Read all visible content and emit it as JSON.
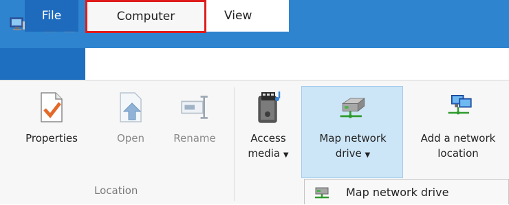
{
  "quick_access": {
    "icons": [
      "computer-icon",
      "properties-icon",
      "new-folder-icon",
      "customize-qat-icon"
    ]
  },
  "tabs": {
    "file": "File",
    "computer": "Computer",
    "view": "View"
  },
  "ribbon": {
    "location_group": {
      "label": "Location",
      "buttons": [
        {
          "label": "Properties",
          "icon": "properties-icon"
        },
        {
          "label": "Open",
          "icon": "open-icon"
        },
        {
          "label": "Rename",
          "icon": "rename-icon"
        }
      ]
    },
    "network_group": {
      "buttons": [
        {
          "label_line1": "Access",
          "label_line2": "media",
          "icon": "access-media-icon"
        },
        {
          "label_line1": "Map network",
          "label_line2": "drive",
          "icon": "map-network-drive-icon"
        },
        {
          "label_line1": "Add a network",
          "label_line2": "location",
          "icon": "add-network-location-icon"
        }
      ]
    }
  },
  "dropdown": {
    "items": [
      {
        "label": "Map network drive",
        "icon": "map-network-drive-icon"
      }
    ]
  },
  "colors": {
    "accent": "#2e84cf",
    "file_tab": "#1e6bbd",
    "highlight": "#e01b1b",
    "selected": "#cde6f7"
  }
}
